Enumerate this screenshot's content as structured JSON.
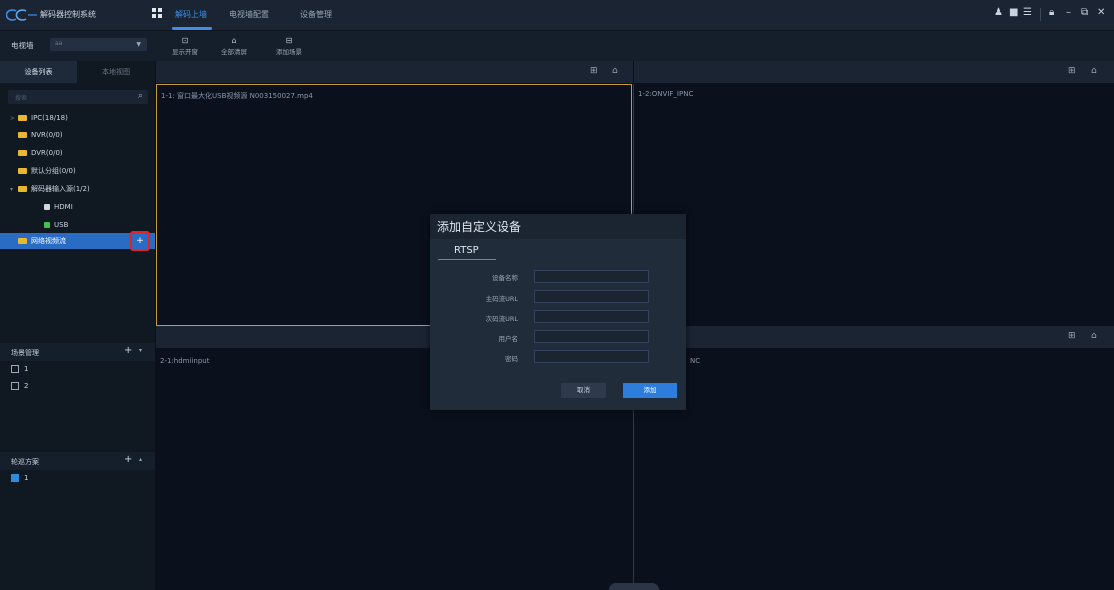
{
  "app": {
    "title": "解码器控制系统"
  },
  "nav": {
    "tabs": [
      {
        "label": "解码上墙",
        "active": true
      },
      {
        "label": "电视墙配置"
      },
      {
        "label": "设备管理"
      }
    ]
  },
  "topbar_right": {
    "icons": [
      "person-icon",
      "monitor-icon",
      "list-icon",
      "lock-icon",
      "minimize-icon",
      "restore-icon",
      "close-icon"
    ]
  },
  "toolbar": {
    "tvwall_label": "电视墙",
    "tvwall_value": "aa",
    "tools": [
      {
        "label": "显示开窗",
        "icon": "window-icon"
      },
      {
        "label": "全部清屏",
        "icon": "clear-icon"
      },
      {
        "label": "添加场景",
        "icon": "scene-icon"
      }
    ]
  },
  "left": {
    "tabs": [
      "设备列表",
      "本地视图"
    ],
    "search_placeholder": "搜索",
    "tree": [
      {
        "label": "IPC(18/18)",
        "type": "folder",
        "level": 0,
        "arrow": ">"
      },
      {
        "label": "NVR(0/0)",
        "type": "folder",
        "level": 0
      },
      {
        "label": "DVR(0/0)",
        "type": "folder",
        "level": 0
      },
      {
        "label": "默认分组(0/0)",
        "type": "folder",
        "level": 0
      },
      {
        "label": "解码器输入源(1/2)",
        "type": "folder",
        "level": 0,
        "arrow": "▾"
      },
      {
        "label": "HDMI",
        "type": "monitor",
        "level": 1,
        "color": "#d0d6de"
      },
      {
        "label": "USB",
        "type": "monitor",
        "level": 1,
        "color": "#3fc44a"
      },
      {
        "label": "网络视频流",
        "type": "folder",
        "level": 0,
        "selected": true
      }
    ],
    "add_stream_symbol": "+",
    "scene_section": {
      "title": "场景管理",
      "plus": "+",
      "caret": "▾",
      "items": [
        "1",
        "2"
      ]
    },
    "tour_section": {
      "title": "轮巡方案",
      "plus": "+",
      "caret": "▴",
      "items": [
        "1"
      ]
    }
  },
  "panes": [
    {
      "title": "1-1: 窗口最大化USB视频源 N003150027.mp4"
    },
    {
      "title": "1-2:ONVIF_IPNC"
    },
    {
      "title": "2-1:hdmiinput"
    },
    {
      "title": "NC"
    }
  ],
  "pane_header_icons": {
    "split": "⊞",
    "clear": "⌂"
  },
  "dialog": {
    "title": "添加自定义设备",
    "tab": "RTSP",
    "fields": [
      {
        "label": "设备名称",
        "value": ""
      },
      {
        "label": "主码流URL",
        "value": ""
      },
      {
        "label": "次码流URL",
        "value": ""
      },
      {
        "label": "用户名",
        "value": ""
      },
      {
        "label": "密码",
        "value": ""
      }
    ],
    "cancel_label": "取消",
    "add_label": "添加"
  }
}
